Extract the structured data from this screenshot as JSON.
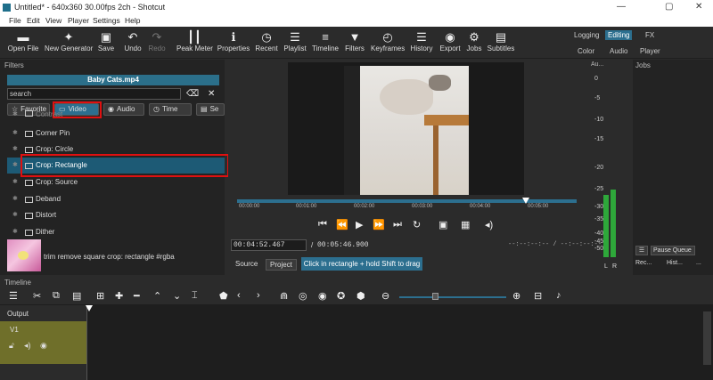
{
  "window": {
    "title": "Untitled* - 640x360 30.00fps 2ch - Shotcut",
    "min": "—",
    "max": "▢",
    "close": "✕"
  },
  "menu": [
    "File",
    "Edit",
    "View",
    "Player",
    "Settings",
    "Help"
  ],
  "toolbar": {
    "items": [
      {
        "label": "Open File",
        "icon": "open-folder-icon",
        "glyph": "▬"
      },
      {
        "label": "New Generator",
        "icon": "wand-icon",
        "glyph": "✦"
      },
      {
        "label": "Save",
        "icon": "save-icon",
        "glyph": "▣"
      },
      {
        "label": "Undo",
        "icon": "undo-icon",
        "glyph": "↶"
      },
      {
        "label": "Redo",
        "icon": "redo-icon",
        "glyph": "↷"
      },
      {
        "label": "Peak Meter",
        "icon": "bars-icon",
        "glyph": "┃┃"
      },
      {
        "label": "Properties",
        "icon": "info-icon",
        "glyph": "ℹ"
      },
      {
        "label": "Recent",
        "icon": "clock-icon",
        "glyph": "◷"
      },
      {
        "label": "Playlist",
        "icon": "playlist-icon",
        "glyph": "☰"
      },
      {
        "label": "Timeline",
        "icon": "timeline-icon",
        "glyph": "≡"
      },
      {
        "label": "Filters",
        "icon": "filter-icon",
        "glyph": "▼"
      },
      {
        "label": "Keyframes",
        "icon": "stopwatch-icon",
        "glyph": "◴"
      },
      {
        "label": "History",
        "icon": "history-icon",
        "glyph": "☰"
      },
      {
        "label": "Export",
        "icon": "export-icon",
        "glyph": "◉"
      },
      {
        "label": "Jobs",
        "icon": "gear-icon",
        "glyph": "⚙"
      },
      {
        "label": "Subtitles",
        "icon": "subtitles-icon",
        "glyph": "▤"
      }
    ],
    "layouts": {
      "row1": [
        "Logging",
        "Editing",
        "FX"
      ],
      "row2": [
        "Color",
        "Audio",
        "Player"
      ]
    }
  },
  "filters": {
    "title": "Filters",
    "clip": "Baby Cats.mp4",
    "search_value": "search",
    "tabs": [
      "Favorite",
      "Video",
      "Audio",
      "Time",
      "Se"
    ],
    "list": [
      "Contrast",
      "Corner Pin",
      "Crop: Circle",
      "Crop: Rectangle",
      "Crop: Source",
      "Deband",
      "Distort",
      "Dither"
    ],
    "selected": "Crop: Rectangle",
    "description": "trim remove square crop: rectangle #rgba"
  },
  "player": {
    "ruler": [
      "00:00:00",
      "00:01:00",
      "00:02:00",
      "00:03:00",
      "00:04:00",
      "00:05:00"
    ],
    "timecode": "00:04:52.467",
    "separator": "/",
    "duration": "00:05:46.900",
    "in_out": "--:--:--:--  /  --:--:--:--",
    "tabs": [
      "Source",
      "Project"
    ],
    "hint": "Click in rectangle + hold Shift to drag"
  },
  "audio": {
    "title": "Au...",
    "levels": [
      "0",
      "-5",
      "-10",
      "-15",
      "-20",
      "-25",
      "-30",
      "-35",
      "-40",
      "-45",
      "-50"
    ],
    "lr": [
      "L",
      "R"
    ]
  },
  "jobs": {
    "title": "Jobs",
    "pause": "Pause Queue",
    "buttons": [
      "Rec...",
      "Hist...",
      "..."
    ]
  },
  "timeline": {
    "title": "Timeline",
    "output": "Output",
    "track": "V1"
  }
}
